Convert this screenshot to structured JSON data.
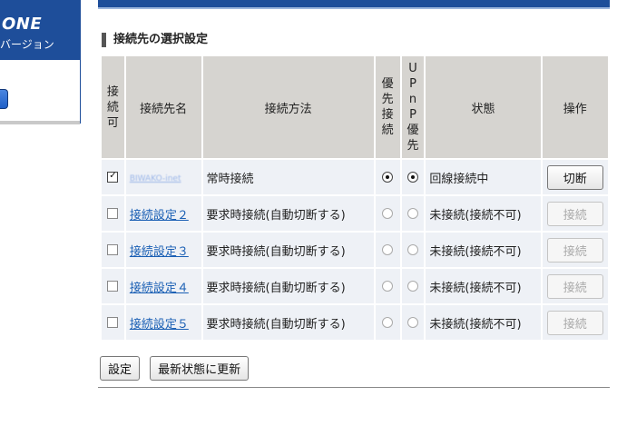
{
  "sidebar": {
    "logo": "ONE",
    "subtitle": "バージョン"
  },
  "section": {
    "title": "接続先の選択設定"
  },
  "table": {
    "headers": {
      "enable": "接続可",
      "name": "接続先名",
      "method": "接続方法",
      "priority": "優先接続",
      "upnp": "UPnP優先",
      "status": "状態",
      "action": "操作"
    },
    "rows": [
      {
        "enabled": true,
        "name": "BIWAKO-inet",
        "name_blurred": true,
        "method": "常時接続",
        "priority": true,
        "upnp": true,
        "status": "回線接続中",
        "action": "切断",
        "action_enabled": true
      },
      {
        "enabled": false,
        "name": "接続設定２",
        "name_blurred": false,
        "method": "要求時接続(自動切断する)",
        "priority": false,
        "upnp": false,
        "status": "未接続(接続不可)",
        "action": "接続",
        "action_enabled": false
      },
      {
        "enabled": false,
        "name": "接続設定３",
        "name_blurred": false,
        "method": "要求時接続(自動切断する)",
        "priority": false,
        "upnp": false,
        "status": "未接続(接続不可)",
        "action": "接続",
        "action_enabled": false
      },
      {
        "enabled": false,
        "name": "接続設定４",
        "name_blurred": false,
        "method": "要求時接続(自動切断する)",
        "priority": false,
        "upnp": false,
        "status": "未接続(接続不可)",
        "action": "接続",
        "action_enabled": false
      },
      {
        "enabled": false,
        "name": "接続設定５",
        "name_blurred": false,
        "method": "要求時接続(自動切断する)",
        "priority": false,
        "upnp": false,
        "status": "未接続(接続不可)",
        "action": "接続",
        "action_enabled": false
      }
    ]
  },
  "buttons": {
    "apply": "設定",
    "refresh": "最新状態に更新"
  }
}
